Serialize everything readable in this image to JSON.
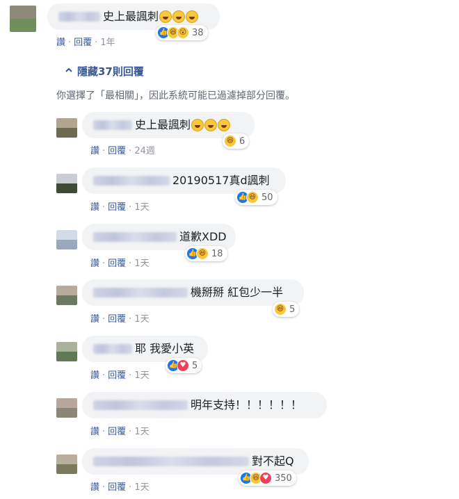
{
  "top_comment": {
    "text": "史上最諷刺",
    "emoji_count": 3,
    "reaction_count": "38",
    "reactions": [
      "like",
      "haha",
      "wow"
    ],
    "actions": {
      "like": "讚",
      "reply": "回覆",
      "time": "1年"
    }
  },
  "replies_toggle": {
    "label": "隱藏37則回覆",
    "chevron": "chevron-up-icon"
  },
  "filter_note": "你選擇了「最相關」，因此系統可能已過濾掉部分回覆。",
  "replies": [
    {
      "text": "史上最諷刺",
      "emoji_count": 3,
      "reactions": [
        "haha"
      ],
      "reaction_count": "6",
      "time": "24週"
    },
    {
      "text": "20190517真d諷刺",
      "emoji_count": 0,
      "reactions": [
        "like",
        "haha"
      ],
      "reaction_count": "50",
      "time": "1天"
    },
    {
      "text": "道歉XDD",
      "emoji_count": 0,
      "reactions": [
        "like",
        "haha"
      ],
      "reaction_count": "18",
      "time": "1天"
    },
    {
      "text": "機掰掰 紅包少一半",
      "emoji_count": 0,
      "reactions": [
        "haha"
      ],
      "reaction_count": "5",
      "time": "1天"
    },
    {
      "text": "耶 我愛小英",
      "emoji_count": 0,
      "reactions": [
        "like",
        "love"
      ],
      "reaction_count": "5",
      "time": "1天"
    },
    {
      "text": "明年支持！！！！！！",
      "emoji_count": 0,
      "reactions": [],
      "reaction_count": "",
      "time": "1天"
    },
    {
      "text": "對不起Q",
      "emoji_count": 0,
      "reactions": [
        "like",
        "haha",
        "love"
      ],
      "reaction_count": "350",
      "time": "1天"
    }
  ],
  "action_labels": {
    "like": "讚",
    "reply": "回覆",
    "dot": "·"
  },
  "colors": {
    "link": "#385898",
    "bubble": "#f2f3f5",
    "like": "#1877f2",
    "haha": "#f7c83b",
    "love": "#f33e58"
  }
}
